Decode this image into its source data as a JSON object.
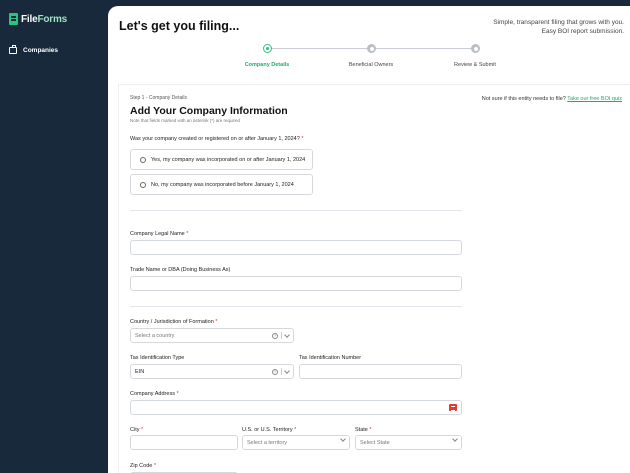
{
  "brand": {
    "name_part1": "File",
    "name_part2": "Forms"
  },
  "sidebar": {
    "items": [
      {
        "label": "Companies"
      }
    ]
  },
  "header": {
    "title": "Let's get you filing...",
    "tagline_line1": "Simple, transparent filing that grows with you.",
    "tagline_line2": "Easy BOI report submission."
  },
  "stepper": {
    "steps": [
      {
        "label": "Company Details",
        "state": "active"
      },
      {
        "label": "Beneficial Owners",
        "state": "pending"
      },
      {
        "label": "Review & Submit",
        "state": "pending"
      }
    ]
  },
  "form": {
    "breadcrumb": "Step 1 - Company Details",
    "title": "Add Your Company Information",
    "note": "Note that fields marked with an asterisk (*) are required",
    "quiz_prefix": "Not sure if this entity needs to file?",
    "quiz_link": "Take our free BOI quiz",
    "incorporation_question": "Was your company created or registered on or after January 1, 2024?",
    "incorporation_options": [
      "Yes, my company was incorporated on or after January 1, 2024",
      "No, my company was incorporated before January 1, 2024"
    ],
    "legal_name_label": "Company Legal Name",
    "trade_name_label": "Trade Name or DBA (Doing Business As)",
    "country_label": "Country / Jurisdiction of Formation",
    "country_placeholder": "Select a country",
    "tax_id_type_label": "Tax Identification Type",
    "tax_id_type_value": "EIN",
    "tax_id_number_label": "Tax Identification Number",
    "address_label": "Company Address",
    "city_label": "City",
    "territory_label": "U.S. or U.S. Territory",
    "territory_placeholder": "Select a territory",
    "state_label": "State",
    "state_placeholder": "Select State",
    "zip_label": "Zip Code",
    "required_mark": "*",
    "help_glyph": "?"
  },
  "colors": {
    "sidebar_bg": "#17293a",
    "accent": "#2ec27e",
    "required": "#d32f2f"
  }
}
